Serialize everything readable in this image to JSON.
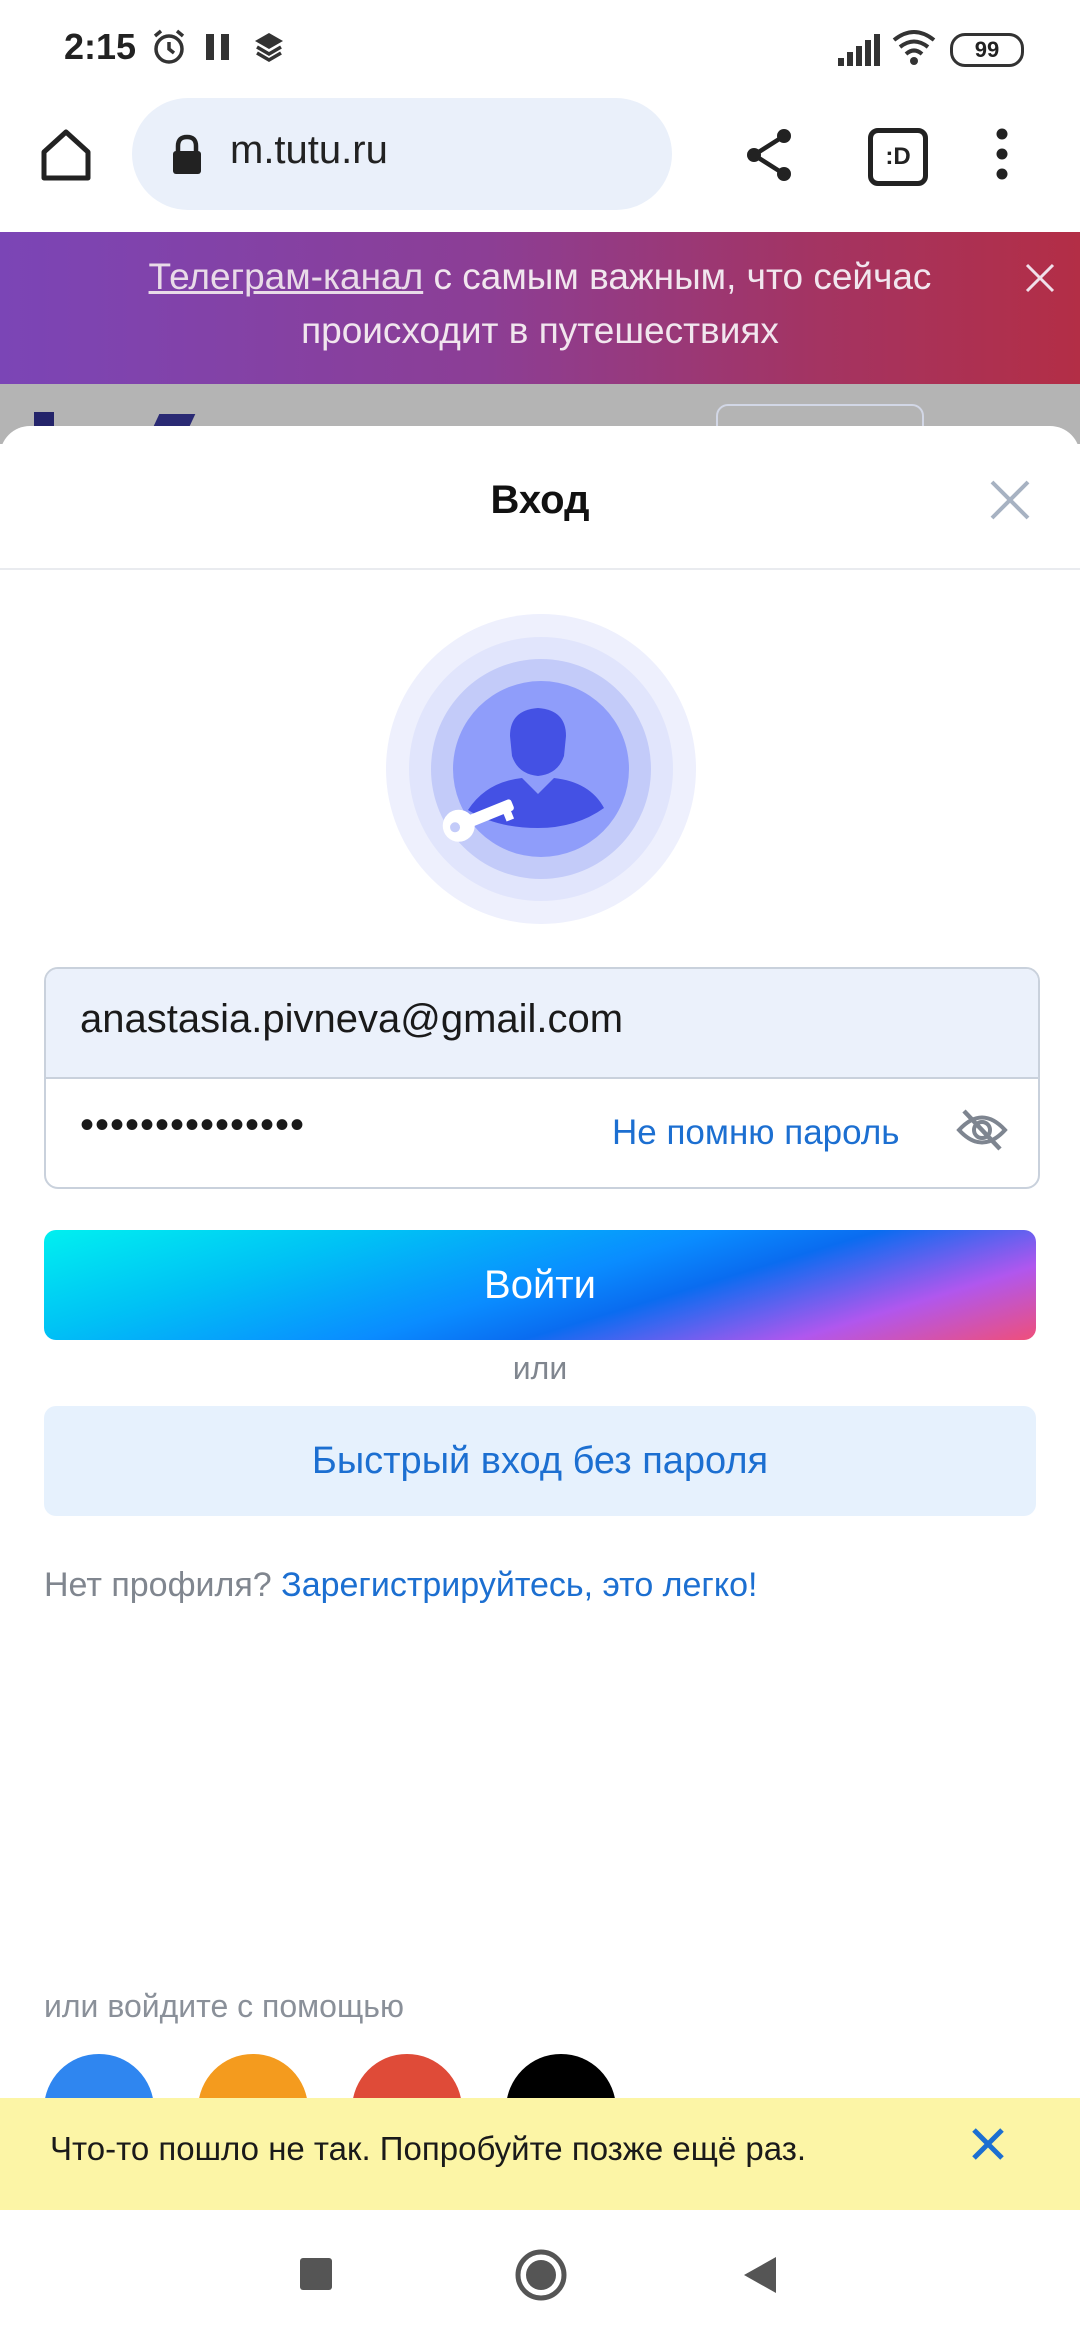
{
  "status_bar": {
    "time": "2:15",
    "battery": "99"
  },
  "browser": {
    "url": "m.tutu.ru",
    "tab_icon_label": ":D"
  },
  "promo_banner": {
    "link_text": "Телеграм-канал",
    "text": " с самым важным, что сейчас происходит в путешествиях"
  },
  "login_sheet": {
    "title": "Вход",
    "email_value": "anastasia.pivneva@gmail.com",
    "password_value": "•••••••••••••••",
    "forgot_password": "Не помню пароль",
    "login_button": "Войти",
    "or_text": "или",
    "quick_login_button": "Быстрый вход без пароля",
    "register_prompt": "Нет профиля?",
    "register_link": "Зарегистрируйтесь, это легко!",
    "social_label": "или войдите с помощью",
    "social_icons": [
      "vk-icon",
      "odnoklassniki-icon",
      "google-icon",
      "apple-icon"
    ]
  },
  "toast": {
    "message": "Что-то пошло не так. Попробуйте позже ещё раз."
  },
  "colors": {
    "accent": "#1c6fd1",
    "toast_bg": "#fcf5a6",
    "banner_start": "#7b45b6",
    "banner_end": "#b32e46"
  }
}
